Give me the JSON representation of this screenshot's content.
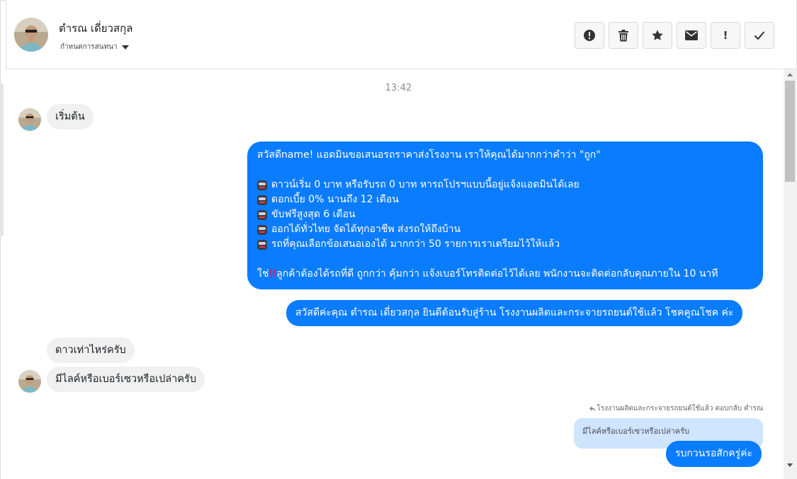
{
  "header": {
    "contact_name": "ตำรณ เดี่ยวสกุล",
    "sub_label": "กำหนดการสนทนา",
    "toolbar": [
      {
        "name": "alert-button",
        "icon": "alert-circle-icon"
      },
      {
        "name": "delete-button",
        "icon": "trash-icon"
      },
      {
        "name": "star-button",
        "icon": "star-icon"
      },
      {
        "name": "mail-button",
        "icon": "envelope-icon"
      },
      {
        "name": "important-button",
        "icon": "exclamation-icon",
        "glyph": "!"
      },
      {
        "name": "done-button",
        "icon": "check-icon"
      }
    ]
  },
  "colors": {
    "outgoing_bubble": "#0a7cff",
    "incoming_bubble": "#f0f0f0",
    "quoted_bubble": "#cfe4fd"
  },
  "conversation": {
    "timestamp": "13:42",
    "messages": [
      {
        "direction": "in",
        "text": "เริ่มต้น"
      },
      {
        "direction": "out",
        "lines": [
          "สวัสดีname! แอดมินขอเสนอรถราคาส่งโรงงาน เราให้คุณได้มากกว่าคำว่า \"ถูก\"",
          "",
          "ดาวน์เริ่ม 0 บาท หรือรับรถ 0 บาท หารถโปรฯแบบนี้อยู่แจ้งแอดมินได้เลย",
          "ดอกเบี้ย 0% นานถึง 12 เดือน",
          "ขับฟรีสูงสุด 6 เดือน",
          "ออกได้ทั่วไทย จัดได้ทุกอาชีพ ส่งรถให้ถึงบ้าน",
          "รถที่คุณเลือกข้อเสนอเองได้ มากกว่า 50 รายการเราเตรียมไว้ให้แล้ว",
          "",
          "ใช่",
          "ลูกค้าต้องได้รถที่ดี ถูกกว่า คุ้มกว่า แจ้งเบอร์โทรติดต่อไว้ได้เลย พนักงานจะติดต่อกลับคุณภายใน 10 นาที"
        ]
      },
      {
        "direction": "out",
        "text": "สวัสดีค่ะคุณ ตำรณ เดี่ยวสกุล ยินดีต้อนรับสู่ร้าน โรงงานผลิตและกระจายรถยนต์ใช้แล้ว โชคคูณโชค ค่ะ"
      },
      {
        "direction": "in",
        "text": "ดาวเท่าไหร่ครับ"
      },
      {
        "direction": "in",
        "text": "มีไลค์หรือเบอร์เซวหรือเปล่าครับ"
      },
      {
        "direction": "out",
        "reply_note": "โรงงานผลิตและกระจายรถยนต์ใช้แล้ว ตอบกลับ ตำรณ",
        "quoted": "มีไลค์หรือเบอร์เซวหรือเปล่าครับ",
        "text": "รบกวนรอสักครู่ค่ะ"
      }
    ]
  }
}
